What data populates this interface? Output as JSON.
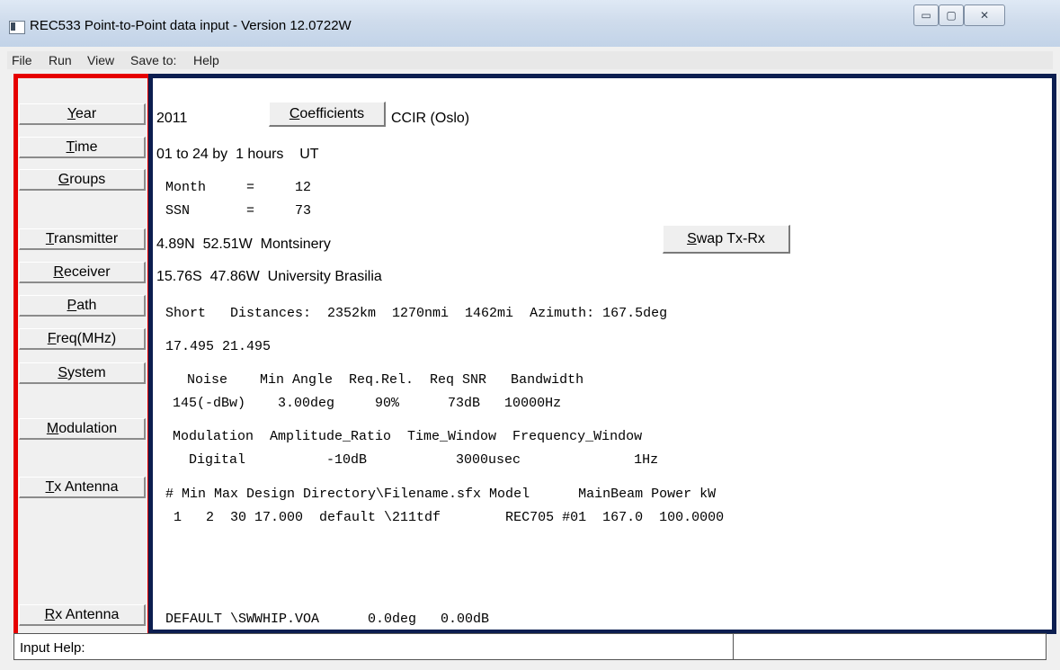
{
  "window": {
    "title": "REC533 Point-to-Point data input - Version 12.0722W",
    "controls": {
      "minimize": "▭",
      "maximize": "▢",
      "close": "✕"
    }
  },
  "menu": [
    "File",
    "Run",
    "View",
    "Save to:",
    "Help"
  ],
  "sidebar": {
    "items": [
      {
        "accel": "Y",
        "rest": "ear"
      },
      {
        "accel": "T",
        "rest": "ime"
      },
      {
        "accel": "G",
        "rest": "roups"
      },
      {
        "accel": "T",
        "rest": "ransmitter"
      },
      {
        "accel": "R",
        "rest": "eceiver"
      },
      {
        "accel": "P",
        "rest": "ath"
      },
      {
        "accel": "F",
        "rest": "req(MHz)"
      },
      {
        "accel": "S",
        "rest": "ystem"
      },
      {
        "accel": "M",
        "rest": "odulation"
      },
      {
        "accel": "T",
        "rest": "x Antenna"
      },
      {
        "accel": "R",
        "rest": "x Antenna"
      }
    ]
  },
  "main": {
    "year": "2011",
    "coefficients_button": {
      "accel": "C",
      "rest": "oefficients"
    },
    "coefficients_value": "CCIR (Oslo)",
    "time": "01 to 24 by  1 hours    UT",
    "month_line": "Month     =     12",
    "ssn_line": "SSN       =     73",
    "transmitter": "4.89N  52.51W  Montsinery",
    "swap_button": {
      "accel": "S",
      "rest": "wap Tx-Rx"
    },
    "receiver": "15.76S  47.86W  University Brasilia",
    "path_line": "Short   Distances:  2352km  1270nmi  1462mi  Azimuth: 167.5deg",
    "freq_line": "17.495 21.495",
    "system_header": "  Noise    Min Angle  Req.Rel.  Req SNR   Bandwidth",
    "system_values": "145(-dBw)    3.00deg     90%      73dB   10000Hz",
    "modulation_header": "Modulation  Amplitude_Ratio  Time_Window  Frequency_Window",
    "modulation_values": "  Digital          -10dB           3000usec              1Hz",
    "tx_antenna_header": "# Min Max Design Directory\\Filename.sfx Model      MainBeam Power kW",
    "tx_antenna_row": " 1   2  30 17.000  default \\211tdf        REC705 #01  167.0  100.0000",
    "rx_antenna_line": "DEFAULT \\SWWHIP.VOA      0.0deg   0.00dB"
  },
  "status": {
    "label": "Input Help:"
  }
}
